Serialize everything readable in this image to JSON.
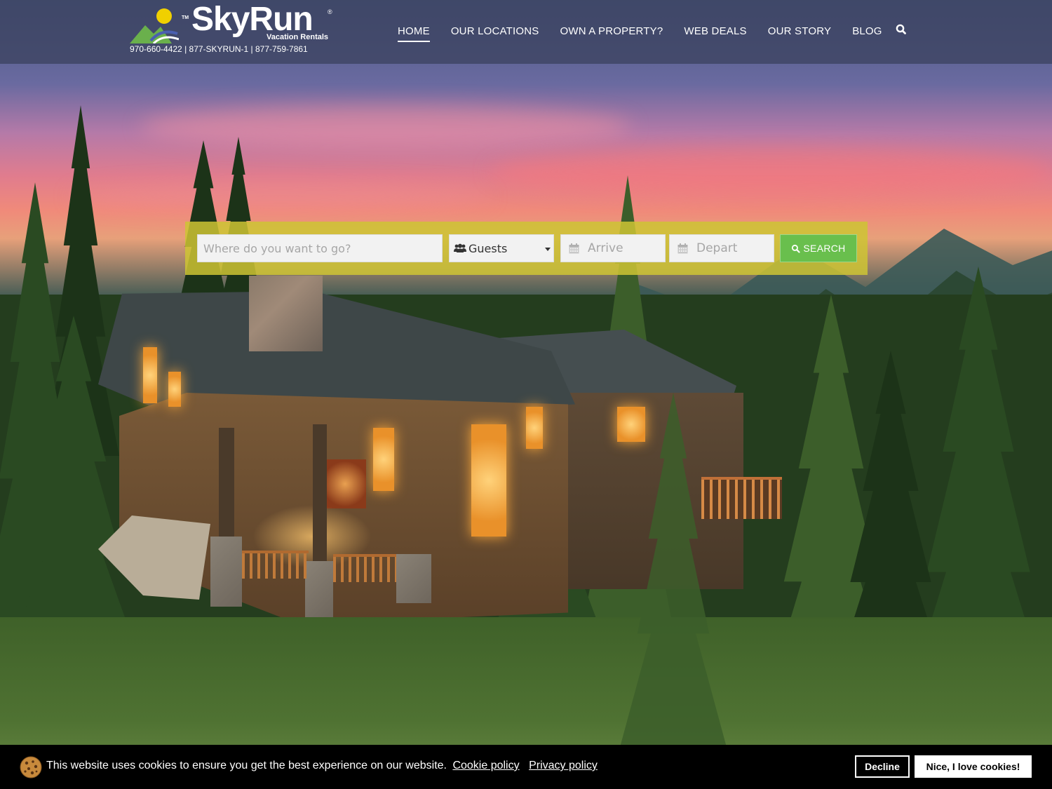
{
  "header": {
    "logo": {
      "brand": "SkyRun",
      "tm": "TM",
      "reg": "®",
      "subtitle": "Vacation Rentals"
    },
    "phones": "970-660-4422 | 877-SKYRUN-1 | 877-759-7861",
    "nav": [
      {
        "label": "HOME",
        "active": true
      },
      {
        "label": "OUR LOCATIONS",
        "active": false
      },
      {
        "label": "OWN A PROPERTY?",
        "active": false
      },
      {
        "label": "WEB DEALS",
        "active": false
      },
      {
        "label": "OUR STORY",
        "active": false
      },
      {
        "label": "BLOG",
        "active": false
      }
    ],
    "search_icon": "search-icon"
  },
  "search": {
    "where_placeholder": "Where do you want to go?",
    "guests_value": "Guests",
    "guests_icon": "users-icon",
    "arrive_placeholder": "Arrive",
    "depart_placeholder": "Depart",
    "calendar_icon": "calendar-icon",
    "button_label": "SEARCH",
    "button_icon": "search-icon"
  },
  "cookie_banner": {
    "icon": "cookie-icon",
    "message": "This website uses cookies to ensure you get the best experience on our website.",
    "cookie_policy_link": "Cookie policy",
    "privacy_policy_link": "Privacy policy",
    "decline_label": "Decline",
    "accept_label": "Nice, I love cookies!"
  },
  "colors": {
    "header_bg": "#3c4260",
    "searchbar_bg": "#cec434",
    "search_button": "#69bf4d",
    "cookie_bg": "#000000"
  }
}
